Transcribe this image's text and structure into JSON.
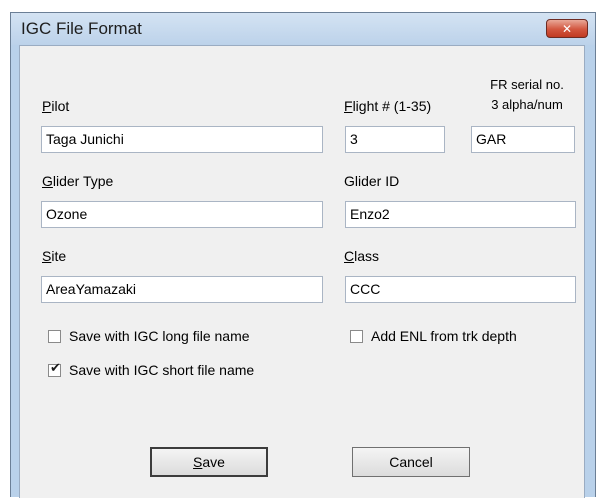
{
  "window": {
    "title": "IGC File Format"
  },
  "labels": {
    "pilot": "Pilot",
    "flight_no": "Flight # (1-35)",
    "fr_serial_line1": "FR serial no.",
    "fr_serial_line2": "3 alpha/num",
    "glider_type": "Glider Type",
    "glider_id": "Glider ID",
    "site": "Site",
    "class": "Class"
  },
  "fields": {
    "pilot": "Taga Junichi",
    "flight_no": "3",
    "fr_serial": "GAR",
    "glider_type": "Ozone",
    "glider_id": "Enzo2",
    "site": "AreaYamazaki",
    "class": "CCC"
  },
  "checkboxes": {
    "long_name": {
      "label": "Save with IGC long file name",
      "checked": false
    },
    "short_name": {
      "label": "Save with IGC short file name",
      "checked": true
    },
    "add_enl": {
      "label": "Add ENL from trk depth",
      "checked": false
    }
  },
  "buttons": {
    "save": "Save",
    "cancel": "Cancel"
  },
  "icons": {
    "close": "close-icon",
    "checkmark": "checkmark-icon"
  }
}
